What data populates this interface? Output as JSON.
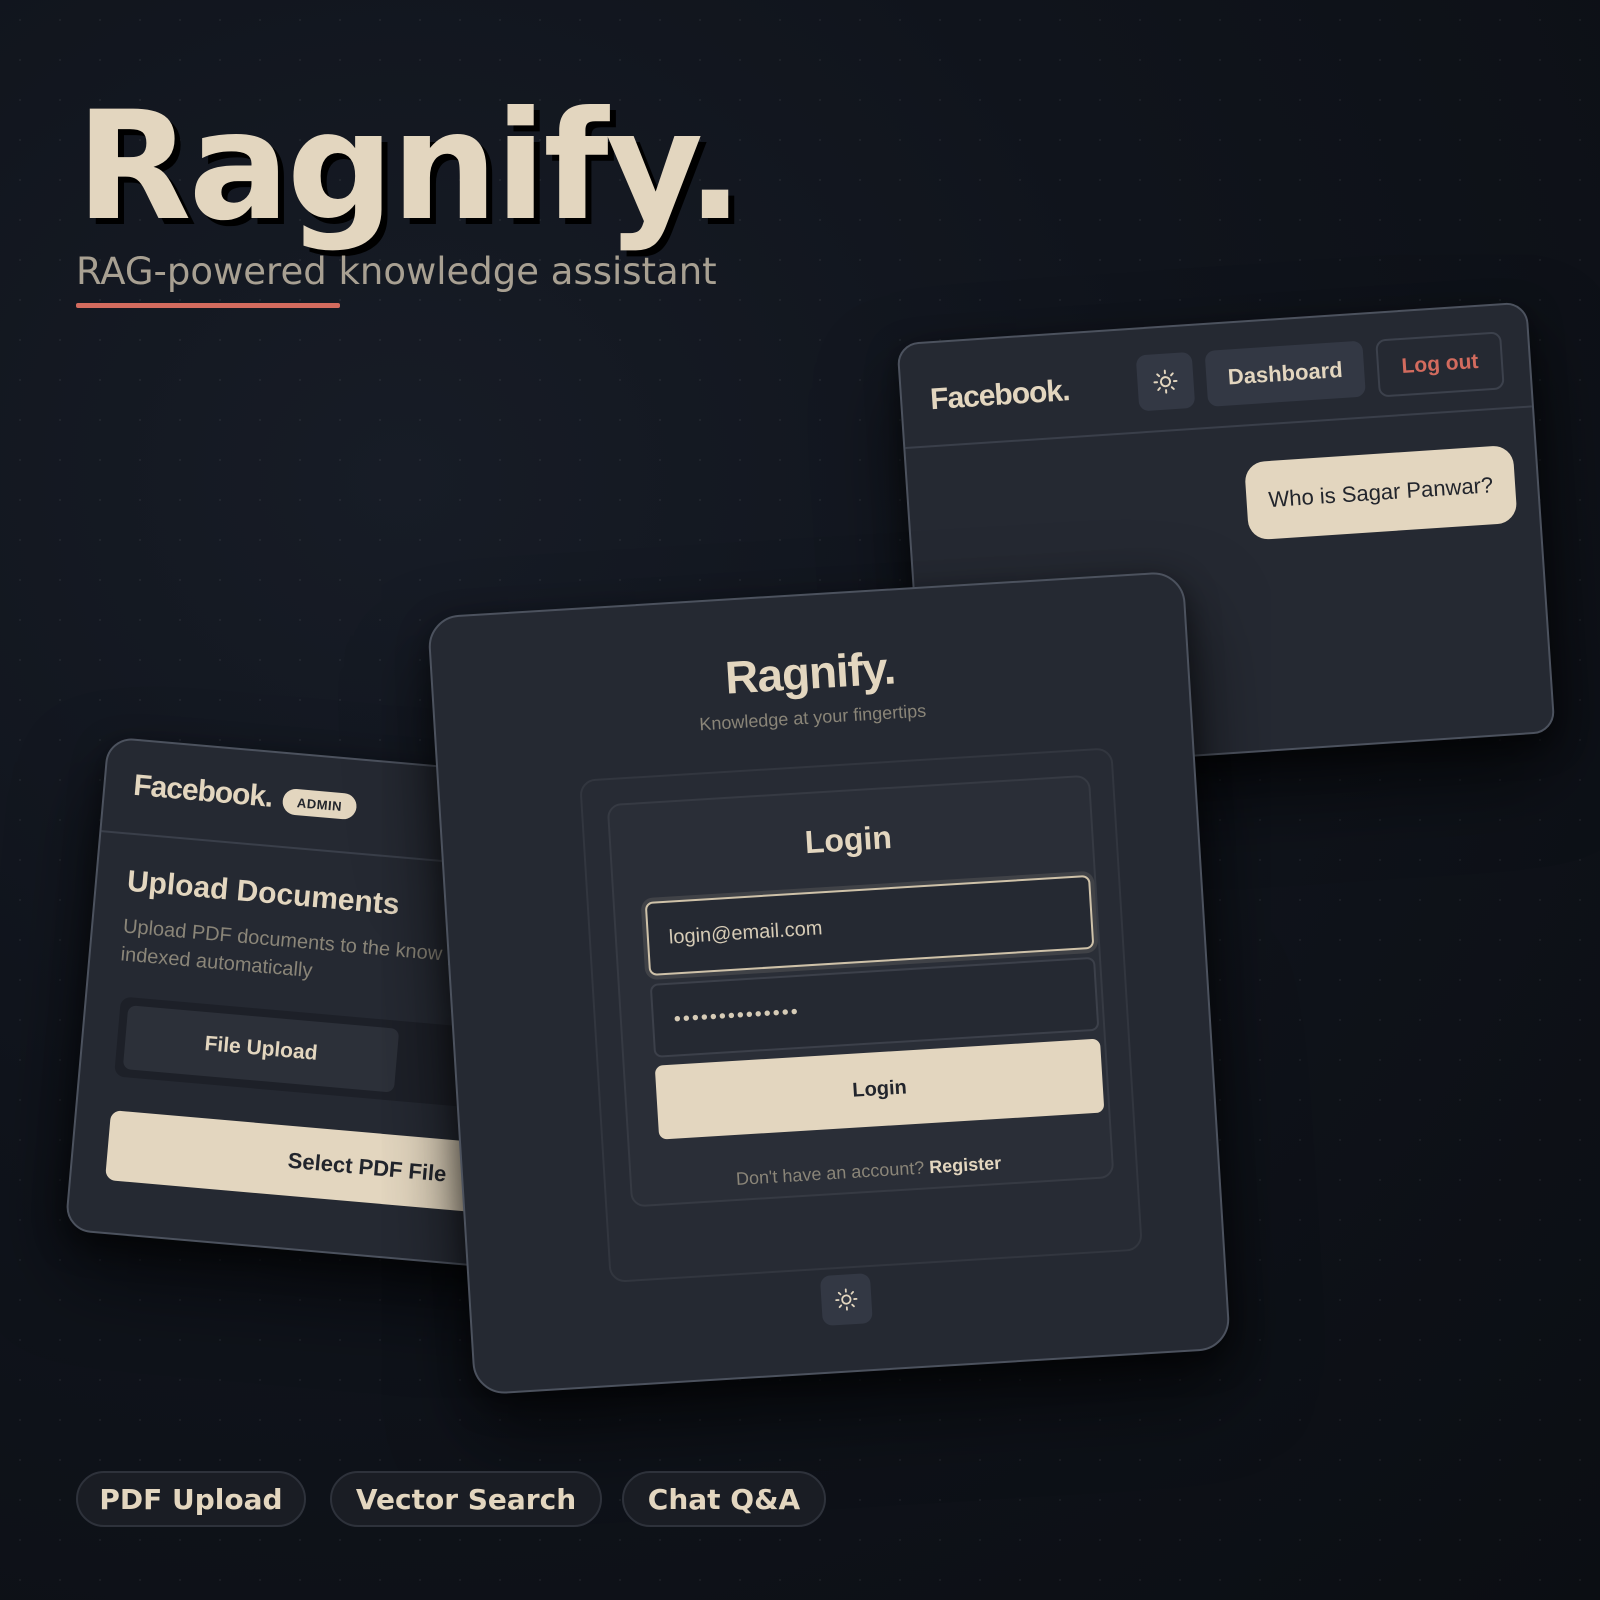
{
  "hero": {
    "title": "Ragnify.",
    "subtitle": "RAG-powered knowledge assistant"
  },
  "chat_window": {
    "brand": "Facebook.",
    "theme_icon": "sun-icon",
    "dashboard_label": "Dashboard",
    "logout_label": "Log out",
    "messages": [
      {
        "role": "user",
        "text": "Who is Sagar Panwar?"
      }
    ]
  },
  "upload_window": {
    "brand": "Facebook.",
    "badge": "ADMIN",
    "title": "Upload Documents",
    "description": "Upload PDF documents to the know processed and indexed automatically",
    "tabs": [
      {
        "label": "File Upload",
        "active": true
      }
    ],
    "select_button": "Select PDF File"
  },
  "login_window": {
    "brand": "Ragnify.",
    "tagline": "Knowledge at your fingertips",
    "heading": "Login",
    "email_value": "login@email.com",
    "password_value": "••••••••••••••",
    "login_button": "Login",
    "register_prompt": "Don't have an account?",
    "register_link": "Register",
    "theme_icon": "sun-icon"
  },
  "features": [
    "PDF Upload",
    "Vector Search",
    "Chat Q&A"
  ],
  "colors": {
    "background": "#0f131a",
    "card": "#252932",
    "cream_accent": "#e3d6bf",
    "danger_accent": "#d36b5e",
    "muted_text": "#8a8578"
  }
}
